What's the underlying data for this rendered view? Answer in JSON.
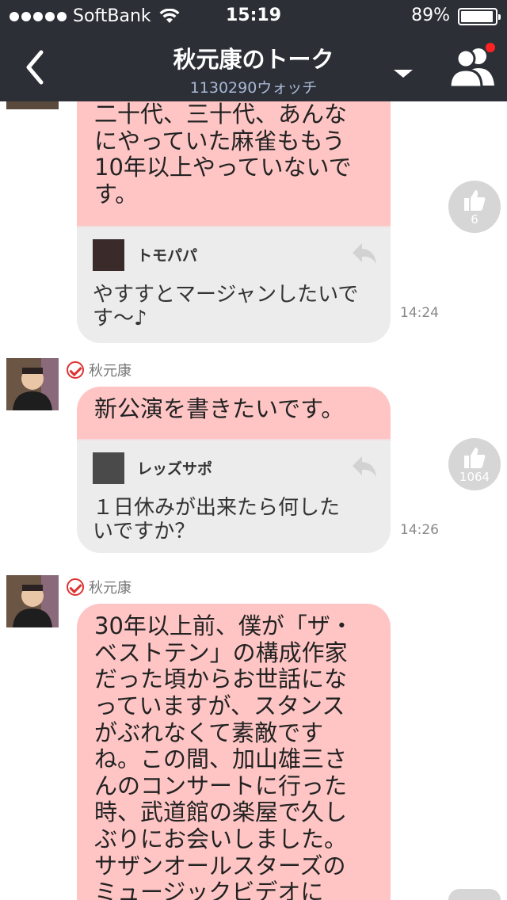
{
  "status_bar": {
    "carrier": "SoftBank",
    "time": "15:19",
    "battery": "89%"
  },
  "nav": {
    "title": "秋元康のトーク",
    "subtitle": "1130290ウォッチ"
  },
  "messages": [
    {
      "text": "二十代、三十代、あんなにやっていた麻雀ももう10年以上やっていないです。",
      "lines": [
        "二十代、三十代、あんな",
        "にやっていた麻雀ももう",
        "10年以上やっていないで",
        "す。"
      ],
      "reply_name": "トモパパ",
      "reply_lines": [
        "やすすとマージャンしたいで",
        "す〜♪"
      ],
      "time": "14:24",
      "likes": "6"
    },
    {
      "sender": "秋元康",
      "lines": [
        "新公演を書きたいです。"
      ],
      "reply_name": "レッズサポ",
      "reply_lines": [
        "１日休みが出来たら何した",
        "いですか？"
      ],
      "time": "14:26",
      "likes": "1064"
    },
    {
      "sender": "秋元康",
      "lines": [
        "30年以上前、僕が「ザ・",
        "ベストテン」の構成作家",
        "だった頃からお世話にな",
        "っていますが、スタンス",
        "がぶれなくて素敵です",
        "ね。この間、加山雄三さ",
        "んのコンサートに行った",
        "時、武道館の楽屋で久し",
        "ぶりにお会いしました。",
        "サザンオールスターズの",
        "ミュージックビデオに"
      ]
    }
  ],
  "colors": {
    "nav_bg": "#2c3036",
    "bubble_pink": "#ffc5c5",
    "reply_gray": "#ececec",
    "like_gray": "#d6d6d6"
  }
}
